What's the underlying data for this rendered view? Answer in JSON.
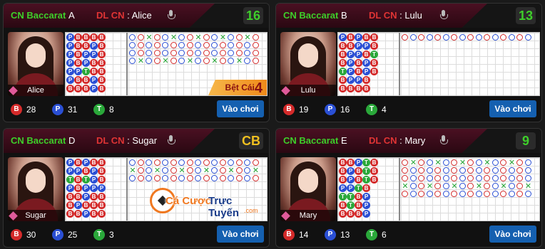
{
  "watermark": {
    "part1": "Cá Cược",
    "part2": "Trực Tuyến",
    "tld": ".com"
  },
  "tables": [
    {
      "id": "A",
      "title": "CN Baccarat",
      "letter": "A",
      "dl_label": "DL CN",
      "dealer": "Alice",
      "count": "16",
      "count_color": "#3ecf2a",
      "banker": "28",
      "player": "31",
      "tie": "8",
      "play_label": "Vào chơi",
      "streak": {
        "text": "Bệt Cái",
        "num": "4"
      },
      "bead": [
        "PBBBB",
        "PBBPB",
        "PBPPB",
        "PBPBB",
        "PPTBB",
        "PBBPB",
        "BBBPB"
      ]
    },
    {
      "id": "B",
      "title": "CN Baccarat",
      "letter": "B",
      "dl_label": "DL CN",
      "dealer": "Lulu",
      "count": "13",
      "count_color": "#3ecf2a",
      "banker": "19",
      "player": "16",
      "tie": "4",
      "play_label": "Vào chơi",
      "bead": [
        "PBPBB",
        "BBPPB",
        "BPPBT",
        "BPBPB",
        "TPBPB",
        "BPPB",
        "BBBB"
      ]
    },
    {
      "id": "D",
      "title": "CN Baccarat",
      "letter": "D",
      "dl_label": "DL CN",
      "dealer": "Sugar",
      "count": "CB",
      "count_color": "#f0c020",
      "banker": "30",
      "player": "25",
      "tie": "3",
      "play_label": "Vào chơi",
      "bead": [
        "PBPBB",
        "PPBPB",
        "TBTPB",
        "PBPPP",
        "BBPBB",
        "BPBBB",
        "BBPBB"
      ]
    },
    {
      "id": "E",
      "title": "CN Baccarat",
      "letter": "E",
      "dl_label": "DL CN",
      "dealer": "Mary",
      "count": "9",
      "count_color": "#3ecf2a",
      "banker": "14",
      "player": "13",
      "tie": "6",
      "play_label": "Vào chơi",
      "bead": [
        "BBPTB",
        "BPBTB",
        "BPBTB",
        "PPTB",
        "TTBP",
        "BTBP",
        "BBBP"
      ]
    }
  ]
}
